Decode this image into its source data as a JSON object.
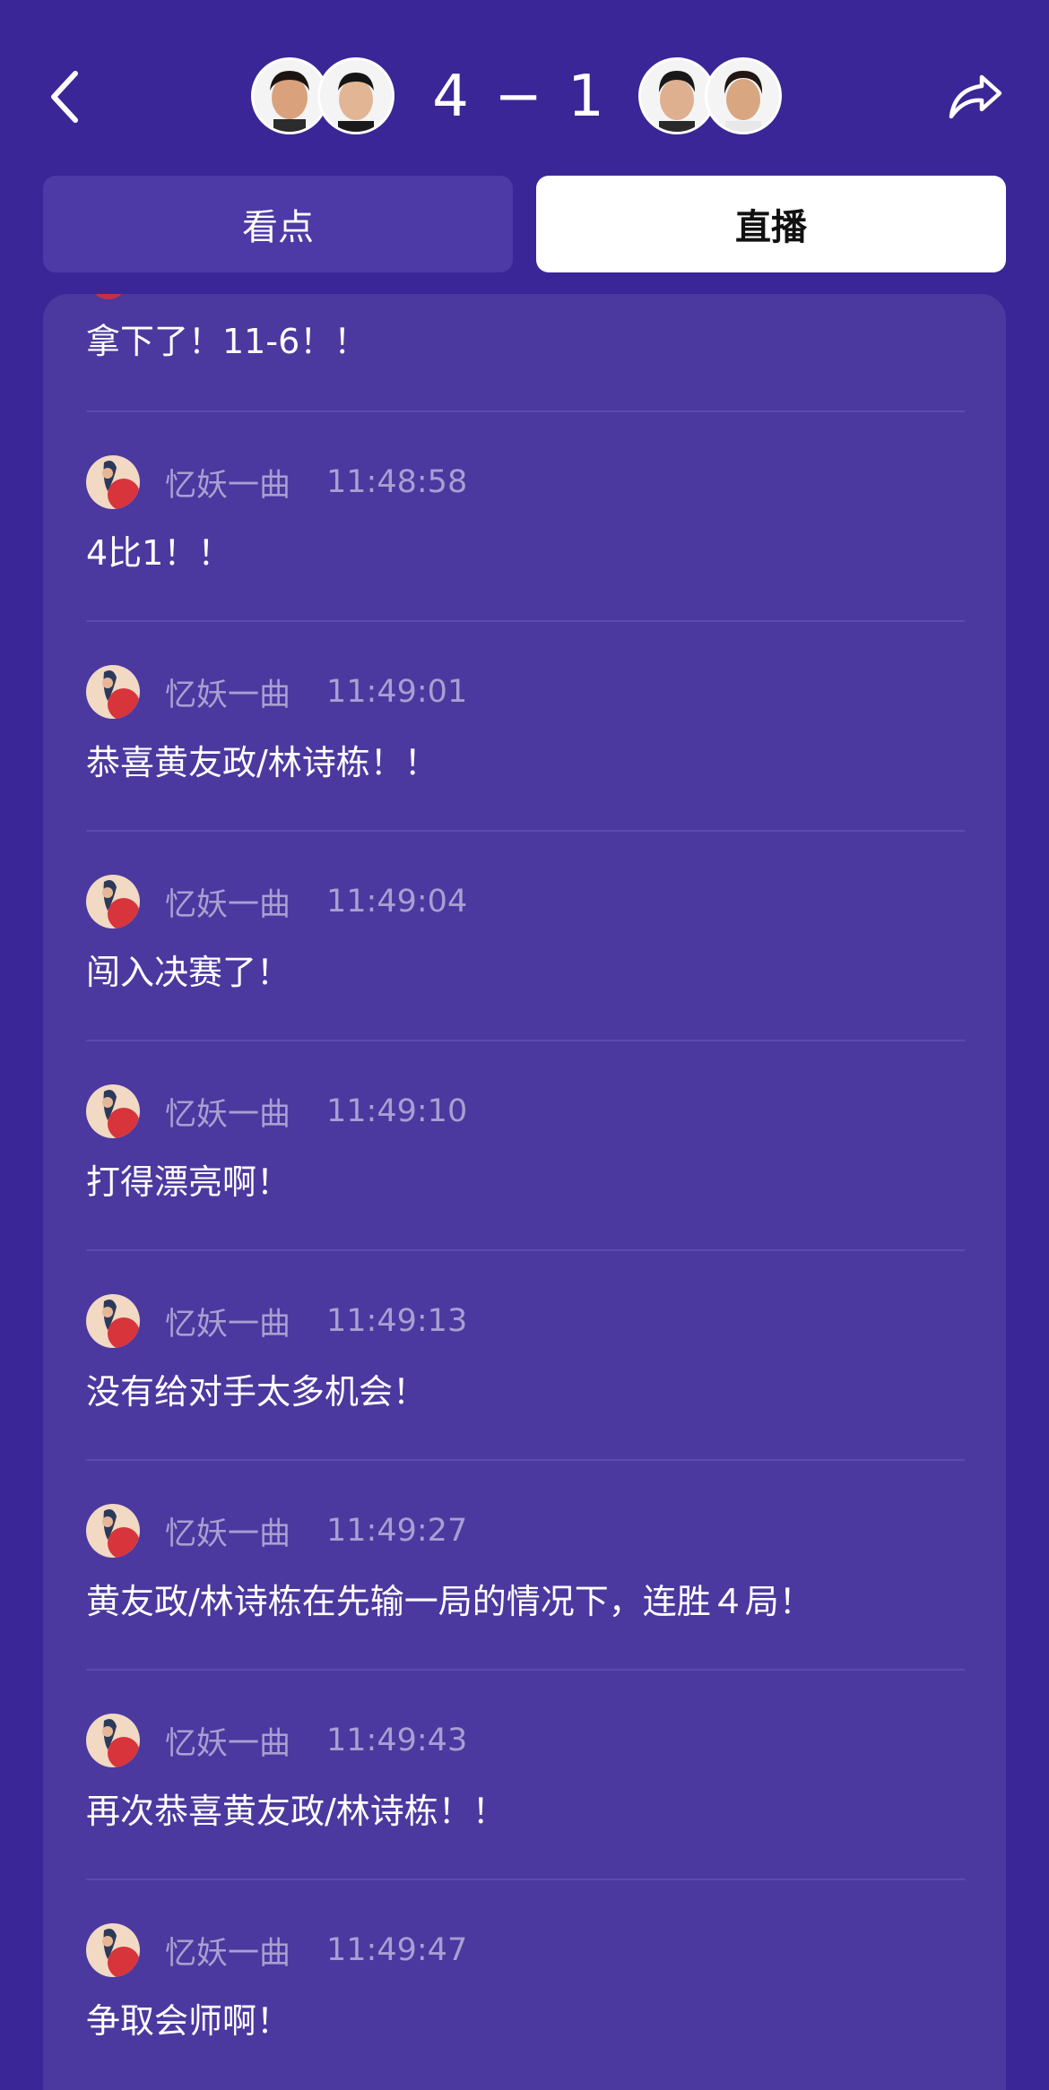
{
  "header": {
    "score": "4 − 1",
    "back_icon": "chevron-left-icon",
    "share_icon": "share-arrow-icon"
  },
  "tabs": [
    {
      "label": "看点",
      "active": false
    },
    {
      "label": "直播",
      "active": true
    }
  ],
  "feed": {
    "partial_message": "拿下了！11-6！！",
    "items": [
      {
        "user": "忆妖一曲",
        "time": "11:48:58",
        "message": "4比1！！"
      },
      {
        "user": "忆妖一曲",
        "time": "11:49:01",
        "message": "恭喜黄友政/林诗栋！！"
      },
      {
        "user": "忆妖一曲",
        "time": "11:49:04",
        "message": "闯入决赛了！"
      },
      {
        "user": "忆妖一曲",
        "time": "11:49:10",
        "message": "打得漂亮啊！"
      },
      {
        "user": "忆妖一曲",
        "time": "11:49:13",
        "message": "没有给对手太多机会！"
      },
      {
        "user": "忆妖一曲",
        "time": "11:49:27",
        "message": "黄友政/林诗栋在先输一局的情况下，连胜４局！"
      },
      {
        "user": "忆妖一曲",
        "time": "11:49:43",
        "message": "再次恭喜黄友政/林诗栋！！"
      },
      {
        "user": "忆妖一曲",
        "time": "11:49:47",
        "message": "争取会师啊！"
      }
    ]
  },
  "colors": {
    "background": "#3a2696",
    "panel": "#4b399f",
    "inactive_tab": "#4d3aa6",
    "active_tab": "#ffffff",
    "meta_text": "#a99fd2",
    "divider": "#5b4bb0"
  }
}
